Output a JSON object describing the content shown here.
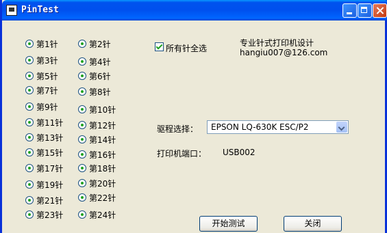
{
  "window": {
    "title": "PinTest"
  },
  "pins": {
    "col1": [
      "第1针",
      "第3针",
      "第5针",
      "第7针",
      "第9针",
      "第11针",
      "第13针",
      "第15针",
      "第17针",
      "第19针",
      "第21针",
      "第23针"
    ],
    "col2": [
      "第2针",
      "第4针",
      "第6针",
      "第8针",
      "第10针",
      "第12针",
      "第14针",
      "第16针",
      "第18针",
      "第20针",
      "第22针",
      "第24针"
    ]
  },
  "select_all_label": "所有针全选",
  "info": {
    "line1": "专业针式打印机设计",
    "line2": "hangiu007@126.com"
  },
  "driver": {
    "label": "驱程选择：",
    "value": "EPSON LQ-630K ESC/P2"
  },
  "port": {
    "label": "打印机端口：",
    "value": "USB002"
  },
  "buttons": {
    "start": "开始测试",
    "close": "关闭"
  }
}
